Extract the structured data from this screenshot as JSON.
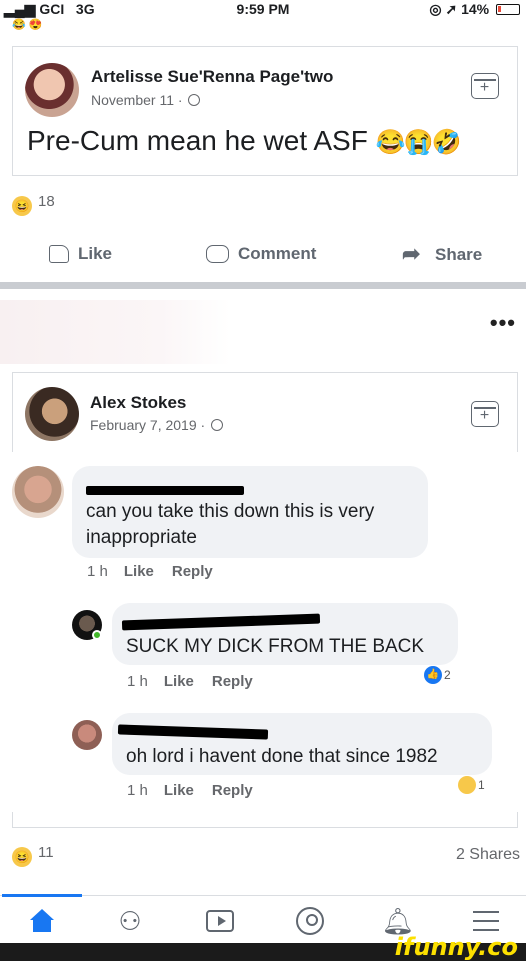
{
  "status_bar": {
    "carrier": "GCI",
    "network": "3G",
    "time": "9:59 PM",
    "battery": "14%"
  },
  "shared_post": {
    "author": "Artelisse Sue'Renna Page'two",
    "date": "November 11 · ",
    "text": "Pre-Cum mean he wet ASF",
    "emojis": "😂😭🤣"
  },
  "reactions": {
    "count": "18"
  },
  "actions": {
    "like": "Like",
    "comment": "Comment",
    "share": "Share"
  },
  "original_post": {
    "author": "Alex Stokes",
    "date": "February 7, 2019 · "
  },
  "comments": [
    {
      "text": "can you take this down this is very inappropriate",
      "time": "1 h",
      "like": "Like",
      "reply": "Reply"
    },
    {
      "text": "SUCK MY DICK FROM THE BACK",
      "time": "1 h",
      "like": "Like",
      "reply": "Reply",
      "reaction_count": "2"
    },
    {
      "text": "oh lord i havent done that since 1982",
      "time": "1 h",
      "like": "Like",
      "reply": "Reply",
      "reaction_count": "1"
    }
  ],
  "footer": {
    "reaction_count": "11",
    "shares": "2 Shares"
  },
  "watermark": "ifunny.co",
  "colors": {
    "facebook_blue": "#1877f2",
    "watermark_yellow": "#fce000"
  }
}
